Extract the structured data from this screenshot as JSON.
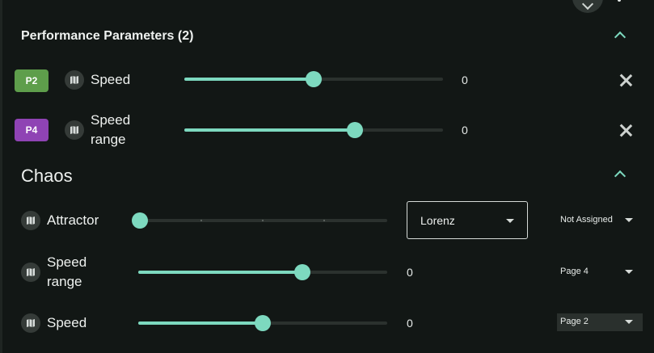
{
  "performance": {
    "title": "Performance Parameters (2)",
    "params": [
      {
        "badge": "P2",
        "badge_color": "#5e9e4b",
        "label": "Speed",
        "value": "0",
        "level": 0.5
      },
      {
        "badge": "P4",
        "badge_color": "#8f43b4",
        "label": "Speed\nrange",
        "value": "0",
        "level": 0.66
      }
    ]
  },
  "chaos": {
    "title": "Chaos",
    "params": [
      {
        "label": "Attractor",
        "level": 0.0,
        "select_value": "Lorenz",
        "assignment": "Not Assigned"
      },
      {
        "label": "Speed\nrange",
        "value": "0",
        "level": 0.66,
        "assignment": "Page 4"
      },
      {
        "label": "Speed",
        "value": "0",
        "level": 0.5,
        "assignment": "Page 2"
      }
    ]
  },
  "colors": {
    "accent": "#7dd9bf",
    "background": "#121715"
  },
  "icons": {
    "param": "map-icon",
    "remove": "close-icon",
    "collapse": "chevron-up-icon",
    "dropdown": "caret-down-icon"
  }
}
